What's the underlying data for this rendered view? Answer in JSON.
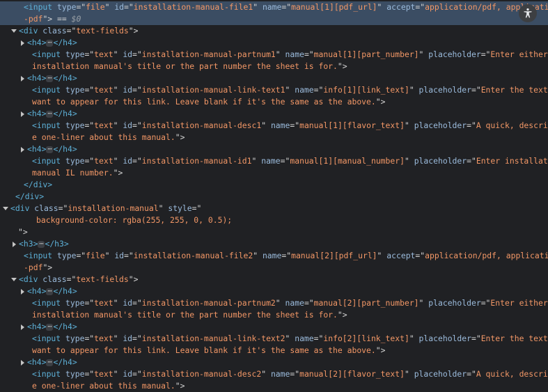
{
  "ui": {
    "ellipsis": "⋯"
  },
  "lines": [
    {
      "indent": 34,
      "selected": true,
      "tri": "none",
      "segs": [
        [
          "tag",
          "<input "
        ],
        [
          "attr",
          "type"
        ],
        [
          "eq",
          "=\""
        ],
        [
          "val",
          "file"
        ],
        [
          "eq",
          "\" "
        ],
        [
          "attr",
          "id"
        ],
        [
          "eq",
          "=\""
        ],
        [
          "val",
          "installation-manual-file1"
        ],
        [
          "eq",
          "\" "
        ],
        [
          "attr",
          "name"
        ],
        [
          "eq",
          "=\""
        ],
        [
          "val",
          "manual[1][pdf_url]"
        ],
        [
          "eq",
          "\" "
        ],
        [
          "attr",
          "accept"
        ],
        [
          "eq",
          "=\""
        ],
        [
          "val",
          "application/pdf, application/x"
        ]
      ]
    },
    {
      "indent": 34,
      "selected": true,
      "tri": "none",
      "segs": [
        [
          "val",
          "-pdf"
        ],
        [
          "eq",
          "\">"
        ],
        [
          "plain",
          " == "
        ],
        [
          "dim",
          "$0"
        ]
      ]
    },
    {
      "indent": 28,
      "tri": "open",
      "segs": [
        [
          "tag",
          "<div "
        ],
        [
          "attr",
          "class"
        ],
        [
          "eq",
          "=\""
        ],
        [
          "val",
          "text-fields"
        ],
        [
          "eq",
          "\">"
        ]
      ]
    },
    {
      "indent": 40,
      "tri": "closed",
      "segs": [
        [
          "tag",
          "<h4>"
        ],
        [
          "ell",
          ""
        ],
        [
          "tag",
          "</h4>"
        ]
      ]
    },
    {
      "indent": 46,
      "tri": "none",
      "segs": [
        [
          "tag",
          "<input "
        ],
        [
          "attr",
          "type"
        ],
        [
          "eq",
          "=\""
        ],
        [
          "val",
          "text"
        ],
        [
          "eq",
          "\" "
        ],
        [
          "attr",
          "id"
        ],
        [
          "eq",
          "=\""
        ],
        [
          "val",
          "installation-manual-partnum1"
        ],
        [
          "eq",
          "\" "
        ],
        [
          "attr",
          "name"
        ],
        [
          "eq",
          "=\""
        ],
        [
          "val",
          "manual[1][part_number]"
        ],
        [
          "eq",
          "\" "
        ],
        [
          "attr",
          "placeholder"
        ],
        [
          "eq",
          "=\""
        ],
        [
          "val",
          "Enter either the"
        ]
      ]
    },
    {
      "indent": 46,
      "tri": "none",
      "segs": [
        [
          "val",
          "installation manual's title or the part number the sheet is for."
        ],
        [
          "eq",
          "\">"
        ]
      ]
    },
    {
      "indent": 40,
      "tri": "closed",
      "segs": [
        [
          "tag",
          "<h4>"
        ],
        [
          "ell",
          ""
        ],
        [
          "tag",
          "</h4>"
        ]
      ]
    },
    {
      "indent": 46,
      "tri": "none",
      "segs": [
        [
          "tag",
          "<input "
        ],
        [
          "attr",
          "type"
        ],
        [
          "eq",
          "=\""
        ],
        [
          "val",
          "text"
        ],
        [
          "eq",
          "\" "
        ],
        [
          "attr",
          "id"
        ],
        [
          "eq",
          "=\""
        ],
        [
          "val",
          "installation-manual-link-text1"
        ],
        [
          "eq",
          "\" "
        ],
        [
          "attr",
          "name"
        ],
        [
          "eq",
          "=\""
        ],
        [
          "val",
          "info[1][link_text]"
        ],
        [
          "eq",
          "\" "
        ],
        [
          "attr",
          "placeholder"
        ],
        [
          "eq",
          "=\""
        ],
        [
          "val",
          "Enter the text you"
        ]
      ]
    },
    {
      "indent": 46,
      "tri": "none",
      "segs": [
        [
          "val",
          "want to appear for this link. Leave blank if it's the same as the above."
        ],
        [
          "eq",
          "\">"
        ]
      ]
    },
    {
      "indent": 40,
      "tri": "closed",
      "segs": [
        [
          "tag",
          "<h4>"
        ],
        [
          "ell",
          ""
        ],
        [
          "tag",
          "</h4>"
        ]
      ]
    },
    {
      "indent": 46,
      "tri": "none",
      "segs": [
        [
          "tag",
          "<input "
        ],
        [
          "attr",
          "type"
        ],
        [
          "eq",
          "=\""
        ],
        [
          "val",
          "text"
        ],
        [
          "eq",
          "\" "
        ],
        [
          "attr",
          "id"
        ],
        [
          "eq",
          "=\""
        ],
        [
          "val",
          "installation-manual-desc1"
        ],
        [
          "eq",
          "\" "
        ],
        [
          "attr",
          "name"
        ],
        [
          "eq",
          "=\""
        ],
        [
          "val",
          "manual[1][flavor_text]"
        ],
        [
          "eq",
          "\" "
        ],
        [
          "attr",
          "placeholder"
        ],
        [
          "eq",
          "=\""
        ],
        [
          "val",
          "A quick, descriptiv"
        ]
      ]
    },
    {
      "indent": 46,
      "tri": "none",
      "segs": [
        [
          "val",
          "e one-liner about this manual."
        ],
        [
          "eq",
          "\">"
        ]
      ]
    },
    {
      "indent": 40,
      "tri": "closed",
      "segs": [
        [
          "tag",
          "<h4>"
        ],
        [
          "ell",
          ""
        ],
        [
          "tag",
          "</h4>"
        ]
      ]
    },
    {
      "indent": 46,
      "tri": "none",
      "segs": [
        [
          "tag",
          "<input "
        ],
        [
          "attr",
          "type"
        ],
        [
          "eq",
          "=\""
        ],
        [
          "val",
          "text"
        ],
        [
          "eq",
          "\" "
        ],
        [
          "attr",
          "id"
        ],
        [
          "eq",
          "=\""
        ],
        [
          "val",
          "installation-manual-id1"
        ],
        [
          "eq",
          "\" "
        ],
        [
          "attr",
          "name"
        ],
        [
          "eq",
          "=\""
        ],
        [
          "val",
          "manual[1][manual_number]"
        ],
        [
          "eq",
          "\" "
        ],
        [
          "attr",
          "placeholder"
        ],
        [
          "eq",
          "=\""
        ],
        [
          "val",
          "Enter installation"
        ]
      ]
    },
    {
      "indent": 46,
      "tri": "none",
      "segs": [
        [
          "val",
          "manual IL number."
        ],
        [
          "eq",
          "\">"
        ]
      ]
    },
    {
      "indent": 34,
      "tri": "none",
      "segs": [
        [
          "tag",
          "</div>"
        ]
      ]
    },
    {
      "indent": 22,
      "tri": "none",
      "segs": [
        [
          "tag",
          "</div>"
        ]
      ]
    },
    {
      "indent": 16,
      "tri": "open",
      "segs": [
        [
          "tag",
          "<div "
        ],
        [
          "attr",
          "class"
        ],
        [
          "eq",
          "=\""
        ],
        [
          "val",
          "installation-manual"
        ],
        [
          "eq",
          "\" "
        ],
        [
          "attr",
          "style"
        ],
        [
          "eq",
          "=\""
        ]
      ]
    },
    {
      "indent": 52,
      "tri": "none",
      "segs": [
        [
          "val",
          "background-color: rgba(255, 255, 0, 0.5);"
        ]
      ]
    },
    {
      "indent": 26,
      "tri": "none",
      "segs": [
        [
          "eq",
          "\">"
        ]
      ]
    },
    {
      "indent": 28,
      "tri": "closed",
      "segs": [
        [
          "tag",
          "<h3>"
        ],
        [
          "ell",
          ""
        ],
        [
          "tag",
          "</h3>"
        ]
      ]
    },
    {
      "indent": 34,
      "tri": "none",
      "segs": [
        [
          "tag",
          "<input "
        ],
        [
          "attr",
          "type"
        ],
        [
          "eq",
          "=\""
        ],
        [
          "val",
          "file"
        ],
        [
          "eq",
          "\" "
        ],
        [
          "attr",
          "id"
        ],
        [
          "eq",
          "=\""
        ],
        [
          "val",
          "installation-manual-file2"
        ],
        [
          "eq",
          "\" "
        ],
        [
          "attr",
          "name"
        ],
        [
          "eq",
          "=\""
        ],
        [
          "val",
          "manual[2][pdf_url]"
        ],
        [
          "eq",
          "\" "
        ],
        [
          "attr",
          "accept"
        ],
        [
          "eq",
          "=\""
        ],
        [
          "val",
          "application/pdf, application/x"
        ]
      ]
    },
    {
      "indent": 34,
      "tri": "none",
      "segs": [
        [
          "val",
          "-pdf"
        ],
        [
          "eq",
          "\">"
        ]
      ]
    },
    {
      "indent": 28,
      "tri": "open",
      "segs": [
        [
          "tag",
          "<div "
        ],
        [
          "attr",
          "class"
        ],
        [
          "eq",
          "=\""
        ],
        [
          "val",
          "text-fields"
        ],
        [
          "eq",
          "\">"
        ]
      ]
    },
    {
      "indent": 40,
      "tri": "closed",
      "segs": [
        [
          "tag",
          "<h4>"
        ],
        [
          "ell",
          ""
        ],
        [
          "tag",
          "</h4>"
        ]
      ]
    },
    {
      "indent": 46,
      "tri": "none",
      "segs": [
        [
          "tag",
          "<input "
        ],
        [
          "attr",
          "type"
        ],
        [
          "eq",
          "=\""
        ],
        [
          "val",
          "text"
        ],
        [
          "eq",
          "\" "
        ],
        [
          "attr",
          "id"
        ],
        [
          "eq",
          "=\""
        ],
        [
          "val",
          "installation-manual-partnum2"
        ],
        [
          "eq",
          "\" "
        ],
        [
          "attr",
          "name"
        ],
        [
          "eq",
          "=\""
        ],
        [
          "val",
          "manual[2][part_number]"
        ],
        [
          "eq",
          "\" "
        ],
        [
          "attr",
          "placeholder"
        ],
        [
          "eq",
          "=\""
        ],
        [
          "val",
          "Enter either the"
        ]
      ]
    },
    {
      "indent": 46,
      "tri": "none",
      "segs": [
        [
          "val",
          "installation manual's title or the part number the sheet is for."
        ],
        [
          "eq",
          "\">"
        ]
      ]
    },
    {
      "indent": 40,
      "tri": "closed",
      "segs": [
        [
          "tag",
          "<h4>"
        ],
        [
          "ell",
          ""
        ],
        [
          "tag",
          "</h4>"
        ]
      ]
    },
    {
      "indent": 46,
      "tri": "none",
      "segs": [
        [
          "tag",
          "<input "
        ],
        [
          "attr",
          "type"
        ],
        [
          "eq",
          "=\""
        ],
        [
          "val",
          "text"
        ],
        [
          "eq",
          "\" "
        ],
        [
          "attr",
          "id"
        ],
        [
          "eq",
          "=\""
        ],
        [
          "val",
          "installation-manual-link-text2"
        ],
        [
          "eq",
          "\" "
        ],
        [
          "attr",
          "name"
        ],
        [
          "eq",
          "=\""
        ],
        [
          "val",
          "info[2][link_text]"
        ],
        [
          "eq",
          "\" "
        ],
        [
          "attr",
          "placeholder"
        ],
        [
          "eq",
          "=\""
        ],
        [
          "val",
          "Enter the text you"
        ]
      ]
    },
    {
      "indent": 46,
      "tri": "none",
      "segs": [
        [
          "val",
          "want to appear for this link. Leave blank if it's the same as the above."
        ],
        [
          "eq",
          "\">"
        ]
      ]
    },
    {
      "indent": 40,
      "tri": "closed",
      "segs": [
        [
          "tag",
          "<h4>"
        ],
        [
          "ell",
          ""
        ],
        [
          "tag",
          "</h4>"
        ]
      ]
    },
    {
      "indent": 46,
      "tri": "none",
      "segs": [
        [
          "tag",
          "<input "
        ],
        [
          "attr",
          "type"
        ],
        [
          "eq",
          "=\""
        ],
        [
          "val",
          "text"
        ],
        [
          "eq",
          "\" "
        ],
        [
          "attr",
          "id"
        ],
        [
          "eq",
          "=\""
        ],
        [
          "val",
          "installation-manual-desc2"
        ],
        [
          "eq",
          "\" "
        ],
        [
          "attr",
          "name"
        ],
        [
          "eq",
          "=\""
        ],
        [
          "val",
          "manual[2][flavor_text]"
        ],
        [
          "eq",
          "\" "
        ],
        [
          "attr",
          "placeholder"
        ],
        [
          "eq",
          "=\""
        ],
        [
          "val",
          "A quick, descriptiv"
        ]
      ]
    },
    {
      "indent": 46,
      "tri": "none",
      "segs": [
        [
          "val",
          "e one-liner about this manual."
        ],
        [
          "eq",
          "\">"
        ]
      ]
    }
  ]
}
